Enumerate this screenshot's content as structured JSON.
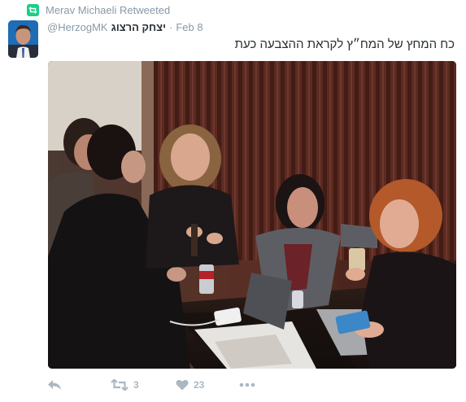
{
  "retweet_context": {
    "text": "Merav Michaeli Retweeted",
    "icon": "retweet-icon"
  },
  "tweet": {
    "author_name": "יצחק הרצוג",
    "author_handle": "@HerzogMK",
    "separator": "·",
    "date": "Feb 8",
    "text": "כח המחץ של המח״ץ לקראת ההצבעה כעת"
  },
  "actions": {
    "reply": {
      "icon": "reply-icon"
    },
    "retweet": {
      "icon": "retweet-icon",
      "count": "3"
    },
    "like": {
      "icon": "heart-icon",
      "count": "23"
    },
    "more": {
      "icon": "more-icon"
    }
  },
  "colors": {
    "retweet_green": "#19cf86",
    "meta_gray": "#8899a6",
    "action_gray": "#aab8c2"
  }
}
